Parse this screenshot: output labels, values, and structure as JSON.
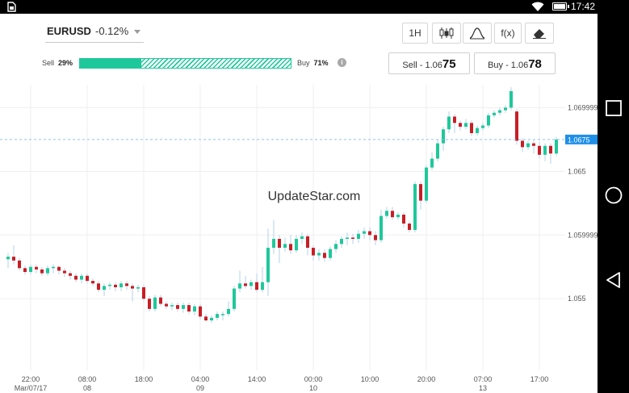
{
  "statusbar": {
    "time": "17:42"
  },
  "instrument": {
    "symbol": "EURUSD",
    "change": "-0.12%"
  },
  "toolbar": {
    "timeframe_label": "1H",
    "indicator_label": "f(x)"
  },
  "sentiment": {
    "sell_label": "Sell",
    "sell_pct": "29%",
    "buy_label": "Buy",
    "buy_pct": "71%",
    "sell_fraction": 0.29,
    "info_glyph": "i"
  },
  "trade": {
    "sell_prefix": "Sell - 1.06",
    "sell_suffix": "75",
    "buy_prefix": "Buy - 1.06",
    "buy_suffix": "78"
  },
  "watermark": "UpdateStar.com",
  "colors": {
    "up": "#1fc89a",
    "down": "#c81e26",
    "accent": "#1e8fe8",
    "sentiment": "#1fc89a"
  },
  "chart_data": {
    "type": "candlestick",
    "price_tag": "1.0675",
    "current_price": 1.0675,
    "ylim": [
      1.0495,
      1.0718
    ],
    "y_ticks": [
      {
        "value": 1.069999,
        "label": "1.069999"
      },
      {
        "value": 1.065,
        "label": "1.065"
      },
      {
        "value": 1.059999,
        "label": "1.059999"
      },
      {
        "value": 1.055,
        "label": "1.055"
      }
    ],
    "x_ticks": [
      {
        "i": 4,
        "time": "22:00",
        "date": "Mar/07/17"
      },
      {
        "i": 14,
        "time": "08:00",
        "date": "08"
      },
      {
        "i": 24,
        "time": "18:00",
        "date": ""
      },
      {
        "i": 34,
        "time": "04:00",
        "date": "09"
      },
      {
        "i": 44,
        "time": "14:00",
        "date": ""
      },
      {
        "i": 54,
        "time": "00:00",
        "date": "10"
      },
      {
        "i": 64,
        "time": "10:00",
        "date": ""
      },
      {
        "i": 74,
        "time": "20:00",
        "date": ""
      },
      {
        "i": 84,
        "time": "07:00",
        "date": "13"
      },
      {
        "i": 94,
        "time": "17:00",
        "date": ""
      }
    ],
    "candles": [
      [
        1.0581,
        1.0583,
        1.0574,
        1.0586
      ],
      [
        1.0583,
        1.058,
        1.0577,
        1.0592
      ],
      [
        1.058,
        1.0574,
        1.0572,
        1.0582
      ],
      [
        1.0574,
        1.0571,
        1.0569,
        1.0576
      ],
      [
        1.0571,
        1.0575,
        1.0569,
        1.0577
      ],
      [
        1.0575,
        1.0573,
        1.057,
        1.0577
      ],
      [
        1.0573,
        1.057,
        1.0568,
        1.0575
      ],
      [
        1.057,
        1.0574,
        1.0568,
        1.0576
      ],
      [
        1.0574,
        1.0575,
        1.057,
        1.0577
      ],
      [
        1.0575,
        1.0572,
        1.0569,
        1.0576
      ],
      [
        1.0572,
        1.057,
        1.0567,
        1.0574
      ],
      [
        1.057,
        1.0568,
        1.0565,
        1.0572
      ],
      [
        1.0568,
        1.0565,
        1.0563,
        1.057
      ],
      [
        1.0565,
        1.0568,
        1.0562,
        1.057
      ],
      [
        1.0568,
        1.0564,
        1.0562,
        1.057
      ],
      [
        1.0564,
        1.0562,
        1.056,
        1.0566
      ],
      [
        1.0562,
        1.0557,
        1.0555,
        1.0564
      ],
      [
        1.0557,
        1.056,
        1.0552,
        1.0562
      ],
      [
        1.056,
        1.0561,
        1.0557,
        1.0563
      ],
      [
        1.0561,
        1.0559,
        1.0556,
        1.0563
      ],
      [
        1.0559,
        1.0562,
        1.0556,
        1.0564
      ],
      [
        1.0562,
        1.056,
        1.0557,
        1.0564
      ],
      [
        1.056,
        1.0558,
        1.0548,
        1.0562
      ],
      [
        1.0558,
        1.0559,
        1.0555,
        1.0561
      ],
      [
        1.0559,
        1.055,
        1.0548,
        1.0561
      ],
      [
        1.055,
        1.0542,
        1.054,
        1.0552
      ],
      [
        1.0542,
        1.0551,
        1.054,
        1.0553
      ],
      [
        1.0551,
        1.0546,
        1.0544,
        1.0553
      ],
      [
        1.0546,
        1.0544,
        1.0542,
        1.0548
      ],
      [
        1.0544,
        1.0545,
        1.0541,
        1.0547
      ],
      [
        1.0545,
        1.0542,
        1.054,
        1.0547
      ],
      [
        1.0542,
        1.0545,
        1.0539,
        1.0547
      ],
      [
        1.0545,
        1.054,
        1.0538,
        1.0547
      ],
      [
        1.054,
        1.0544,
        1.0537,
        1.0546
      ],
      [
        1.0544,
        1.0536,
        1.0534,
        1.0546
      ],
      [
        1.0536,
        1.0533,
        1.0532,
        1.0538
      ],
      [
        1.0533,
        1.0535,
        1.0531,
        1.0537
      ],
      [
        1.0535,
        1.0538,
        1.0533,
        1.054
      ],
      [
        1.0538,
        1.0538,
        1.0533,
        1.054
      ],
      [
        1.0538,
        1.0542,
        1.0536,
        1.0548
      ],
      [
        1.0542,
        1.0558,
        1.054,
        1.056
      ],
      [
        1.0558,
        1.0562,
        1.0555,
        1.0572
      ],
      [
        1.0562,
        1.056,
        1.0558,
        1.0568
      ],
      [
        1.056,
        1.0563,
        1.0557,
        1.0565
      ],
      [
        1.0563,
        1.0557,
        1.0555,
        1.057
      ],
      [
        1.0557,
        1.0563,
        1.0555,
        1.0575
      ],
      [
        1.0563,
        1.059,
        1.0552,
        1.0605
      ],
      [
        1.059,
        1.0597,
        1.0585,
        1.0612
      ],
      [
        1.0597,
        1.059,
        1.0578,
        1.06
      ],
      [
        1.059,
        1.0593,
        1.0587,
        1.0598
      ],
      [
        1.0593,
        1.0588,
        1.0585,
        1.06
      ],
      [
        1.0588,
        1.0597,
        1.0586,
        1.06
      ],
      [
        1.0597,
        1.0599,
        1.0593,
        1.0602
      ],
      [
        1.0599,
        1.059,
        1.0584,
        1.0601
      ],
      [
        1.059,
        1.0584,
        1.058,
        1.0592
      ],
      [
        1.0584,
        1.0586,
        1.058,
        1.0589
      ],
      [
        1.0586,
        1.0582,
        1.0579,
        1.0589
      ],
      [
        1.0582,
        1.0589,
        1.058,
        1.0591
      ],
      [
        1.0589,
        1.0593,
        1.0586,
        1.0596
      ],
      [
        1.0593,
        1.0597,
        1.059,
        1.0599
      ],
      [
        1.0597,
        1.0598,
        1.0592,
        1.0602
      ],
      [
        1.0598,
        1.0597,
        1.0593,
        1.0601
      ],
      [
        1.0597,
        1.0601,
        1.0594,
        1.0604
      ],
      [
        1.0601,
        1.0603,
        1.0597,
        1.0606
      ],
      [
        1.0603,
        1.06,
        1.0596,
        1.0606
      ],
      [
        1.06,
        1.0596,
        1.0592,
        1.0603
      ],
      [
        1.0596,
        1.0615,
        1.0594,
        1.062
      ],
      [
        1.0615,
        1.0619,
        1.0613,
        1.0622
      ],
      [
        1.0619,
        1.0614,
        1.0612,
        1.0622
      ],
      [
        1.0614,
        1.0616,
        1.0612,
        1.0618
      ],
      [
        1.0616,
        1.0609,
        1.0606,
        1.0618
      ],
      [
        1.0609,
        1.0604,
        1.0602,
        1.0611
      ],
      [
        1.0604,
        1.064,
        1.0602,
        1.0642
      ],
      [
        1.064,
        1.0627,
        1.062,
        1.0642
      ],
      [
        1.0627,
        1.0653,
        1.0625,
        1.0655
      ],
      [
        1.0653,
        1.066,
        1.0651,
        1.0665
      ],
      [
        1.066,
        1.0672,
        1.0658,
        1.0675
      ],
      [
        1.0672,
        1.0683,
        1.0666,
        1.0685
      ],
      [
        1.0683,
        1.0693,
        1.068,
        1.0697
      ],
      [
        1.0693,
        1.0688,
        1.068,
        1.0695
      ],
      [
        1.0688,
        1.0685,
        1.0682,
        1.069
      ],
      [
        1.0685,
        1.0688,
        1.0683,
        1.0691
      ],
      [
        1.0688,
        1.068,
        1.0678,
        1.069
      ],
      [
        1.068,
        1.0684,
        1.0678,
        1.0686
      ],
      [
        1.0684,
        1.0686,
        1.0682,
        1.0688
      ],
      [
        1.0686,
        1.0694,
        1.0684,
        1.0696
      ],
      [
        1.0694,
        1.0696,
        1.0692,
        1.0698
      ],
      [
        1.0696,
        1.0698,
        1.0694,
        1.07
      ],
      [
        1.0698,
        1.07,
        1.0696,
        1.0702
      ],
      [
        1.07,
        1.0713,
        1.0698,
        1.0716
      ],
      [
        1.0697,
        1.0674,
        1.0671,
        1.0699
      ],
      [
        1.0674,
        1.0669,
        1.0665,
        1.0676
      ],
      [
        1.0669,
        1.0672,
        1.0667,
        1.0674
      ],
      [
        1.0672,
        1.067,
        1.0664,
        1.0674
      ],
      [
        1.067,
        1.0663,
        1.066,
        1.0673
      ],
      [
        1.0663,
        1.067,
        1.0658,
        1.0672
      ],
      [
        1.067,
        1.0664,
        1.0656,
        1.0672
      ],
      [
        1.0664,
        1.0675,
        1.0662,
        1.0677
      ]
    ]
  }
}
